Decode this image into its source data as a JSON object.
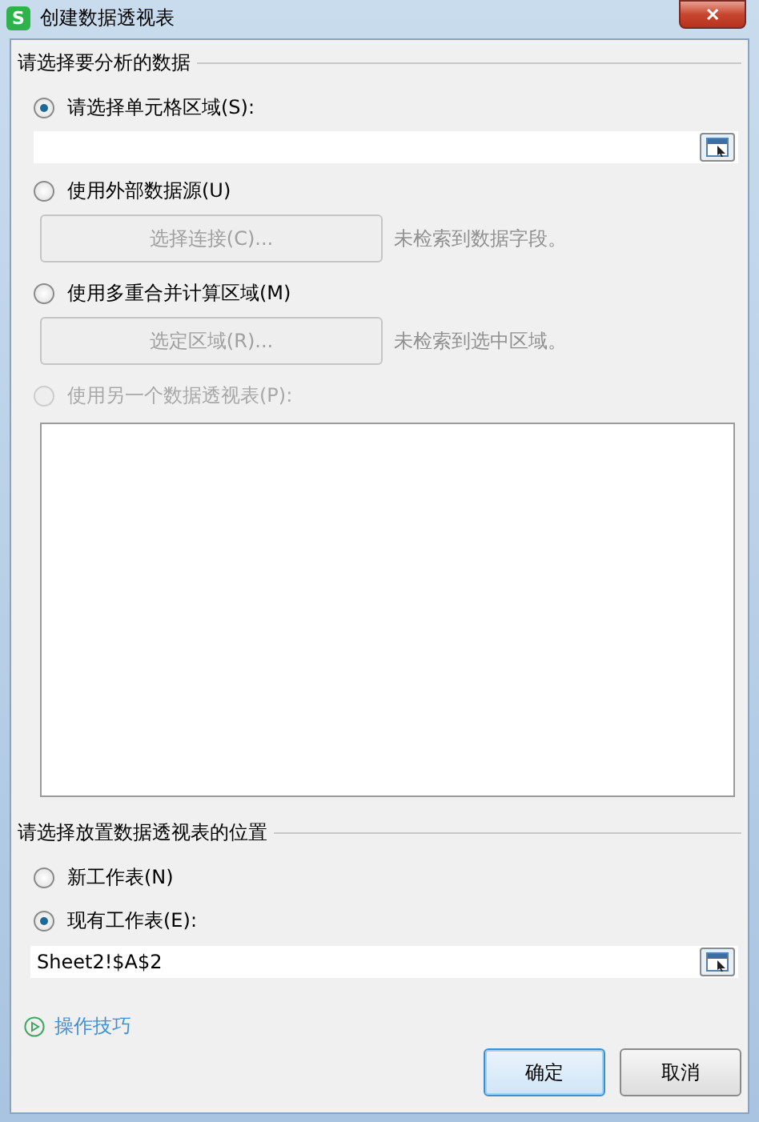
{
  "window": {
    "title": "创建数据透视表",
    "app_icon": "S",
    "close": "✕"
  },
  "source": {
    "title": "请选择要分析的数据",
    "options": [
      {
        "kind": "range",
        "label": "请选择单元格区域(S):",
        "selected": true,
        "disabled": false
      },
      {
        "kind": "action",
        "label": "使用外部数据源(U)",
        "selected": false,
        "disabled": false,
        "button": "选择连接(C)...",
        "button_disabled": true,
        "note": "未检索到数据字段。"
      },
      {
        "kind": "action",
        "label": "使用多重合并计算区域(M)",
        "selected": false,
        "disabled": false,
        "button": "选定区域(R)...",
        "button_disabled": true,
        "note": "未检索到选中区域。"
      },
      {
        "kind": "list",
        "label": "使用另一个数据透视表(P):",
        "selected": false,
        "disabled": true
      }
    ]
  },
  "destination": {
    "title": "请选择放置数据透视表的位置",
    "options": [
      {
        "label": "新工作表(N)",
        "selected": false,
        "disabled": false
      },
      {
        "label": "现有工作表(E):",
        "selected": true,
        "disabled": false
      }
    ],
    "value": "Sheet2!$A$2"
  },
  "tips": "操作技巧",
  "buttons": [
    {
      "label": "确定",
      "default": true
    },
    {
      "label": "取消",
      "default": false
    }
  ]
}
